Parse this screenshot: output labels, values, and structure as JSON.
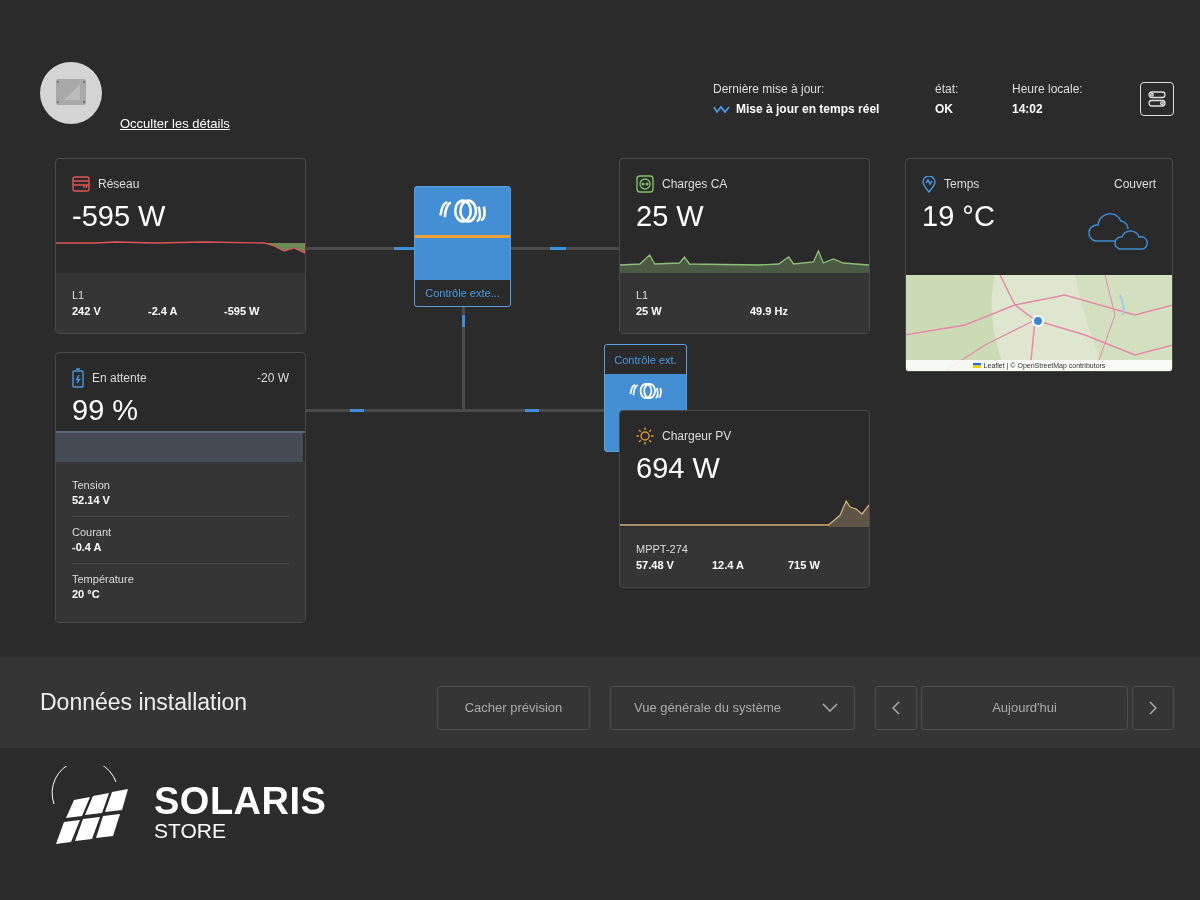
{
  "header": {
    "hide_details_link": "Occulter les détails",
    "status": [
      {
        "label": "Dernière mise à jour:",
        "value": "Mise à jour en temps réel",
        "kind": "live"
      },
      {
        "label": "état:",
        "value": "OK",
        "kind": "plain"
      },
      {
        "label": "Heure locale:",
        "value": "14:02",
        "kind": "plain"
      }
    ]
  },
  "nodes": {
    "grid": {
      "title": "Réseau",
      "value": "-595 W",
      "phase": "L1",
      "readings": [
        "242 V",
        "-2.4 A",
        "-595 W"
      ]
    },
    "inverter": {
      "label": "Contrôle exte..."
    },
    "ac_loads": {
      "title": "Charges CA",
      "value": "25 W",
      "phase": "L1",
      "readings": [
        "25 W",
        "49.9 Hz"
      ]
    },
    "weather": {
      "title": "Temps",
      "condition": "Couvert",
      "value": "19 °C",
      "map_attribution": "Leaflet | © OpenStreetMap contributors"
    },
    "battery": {
      "title": "En attente",
      "power": "-20 W",
      "value": "99 %",
      "level": 0.99,
      "details": [
        {
          "label": "Tension",
          "value": "52.14 V"
        },
        {
          "label": "Courant",
          "value": "-0.4 A"
        },
        {
          "label": "Température",
          "value": "20 °C"
        }
      ]
    },
    "ext_control": {
      "label": "Contrôle ext."
    },
    "pv": {
      "title": "Chargeur PV",
      "value": "694 W",
      "phase": "MPPT-274",
      "readings": [
        "57.48 V",
        "12.4 A",
        "715 W"
      ]
    }
  },
  "bottom_bar": {
    "title": "Données installation",
    "hide_forecast_button": "Cacher prévision",
    "view_select": "Vue générale du système",
    "date_button": "Aujourd'hui"
  },
  "logo": {
    "name": "SOLARIS",
    "sub": "STORE"
  }
}
